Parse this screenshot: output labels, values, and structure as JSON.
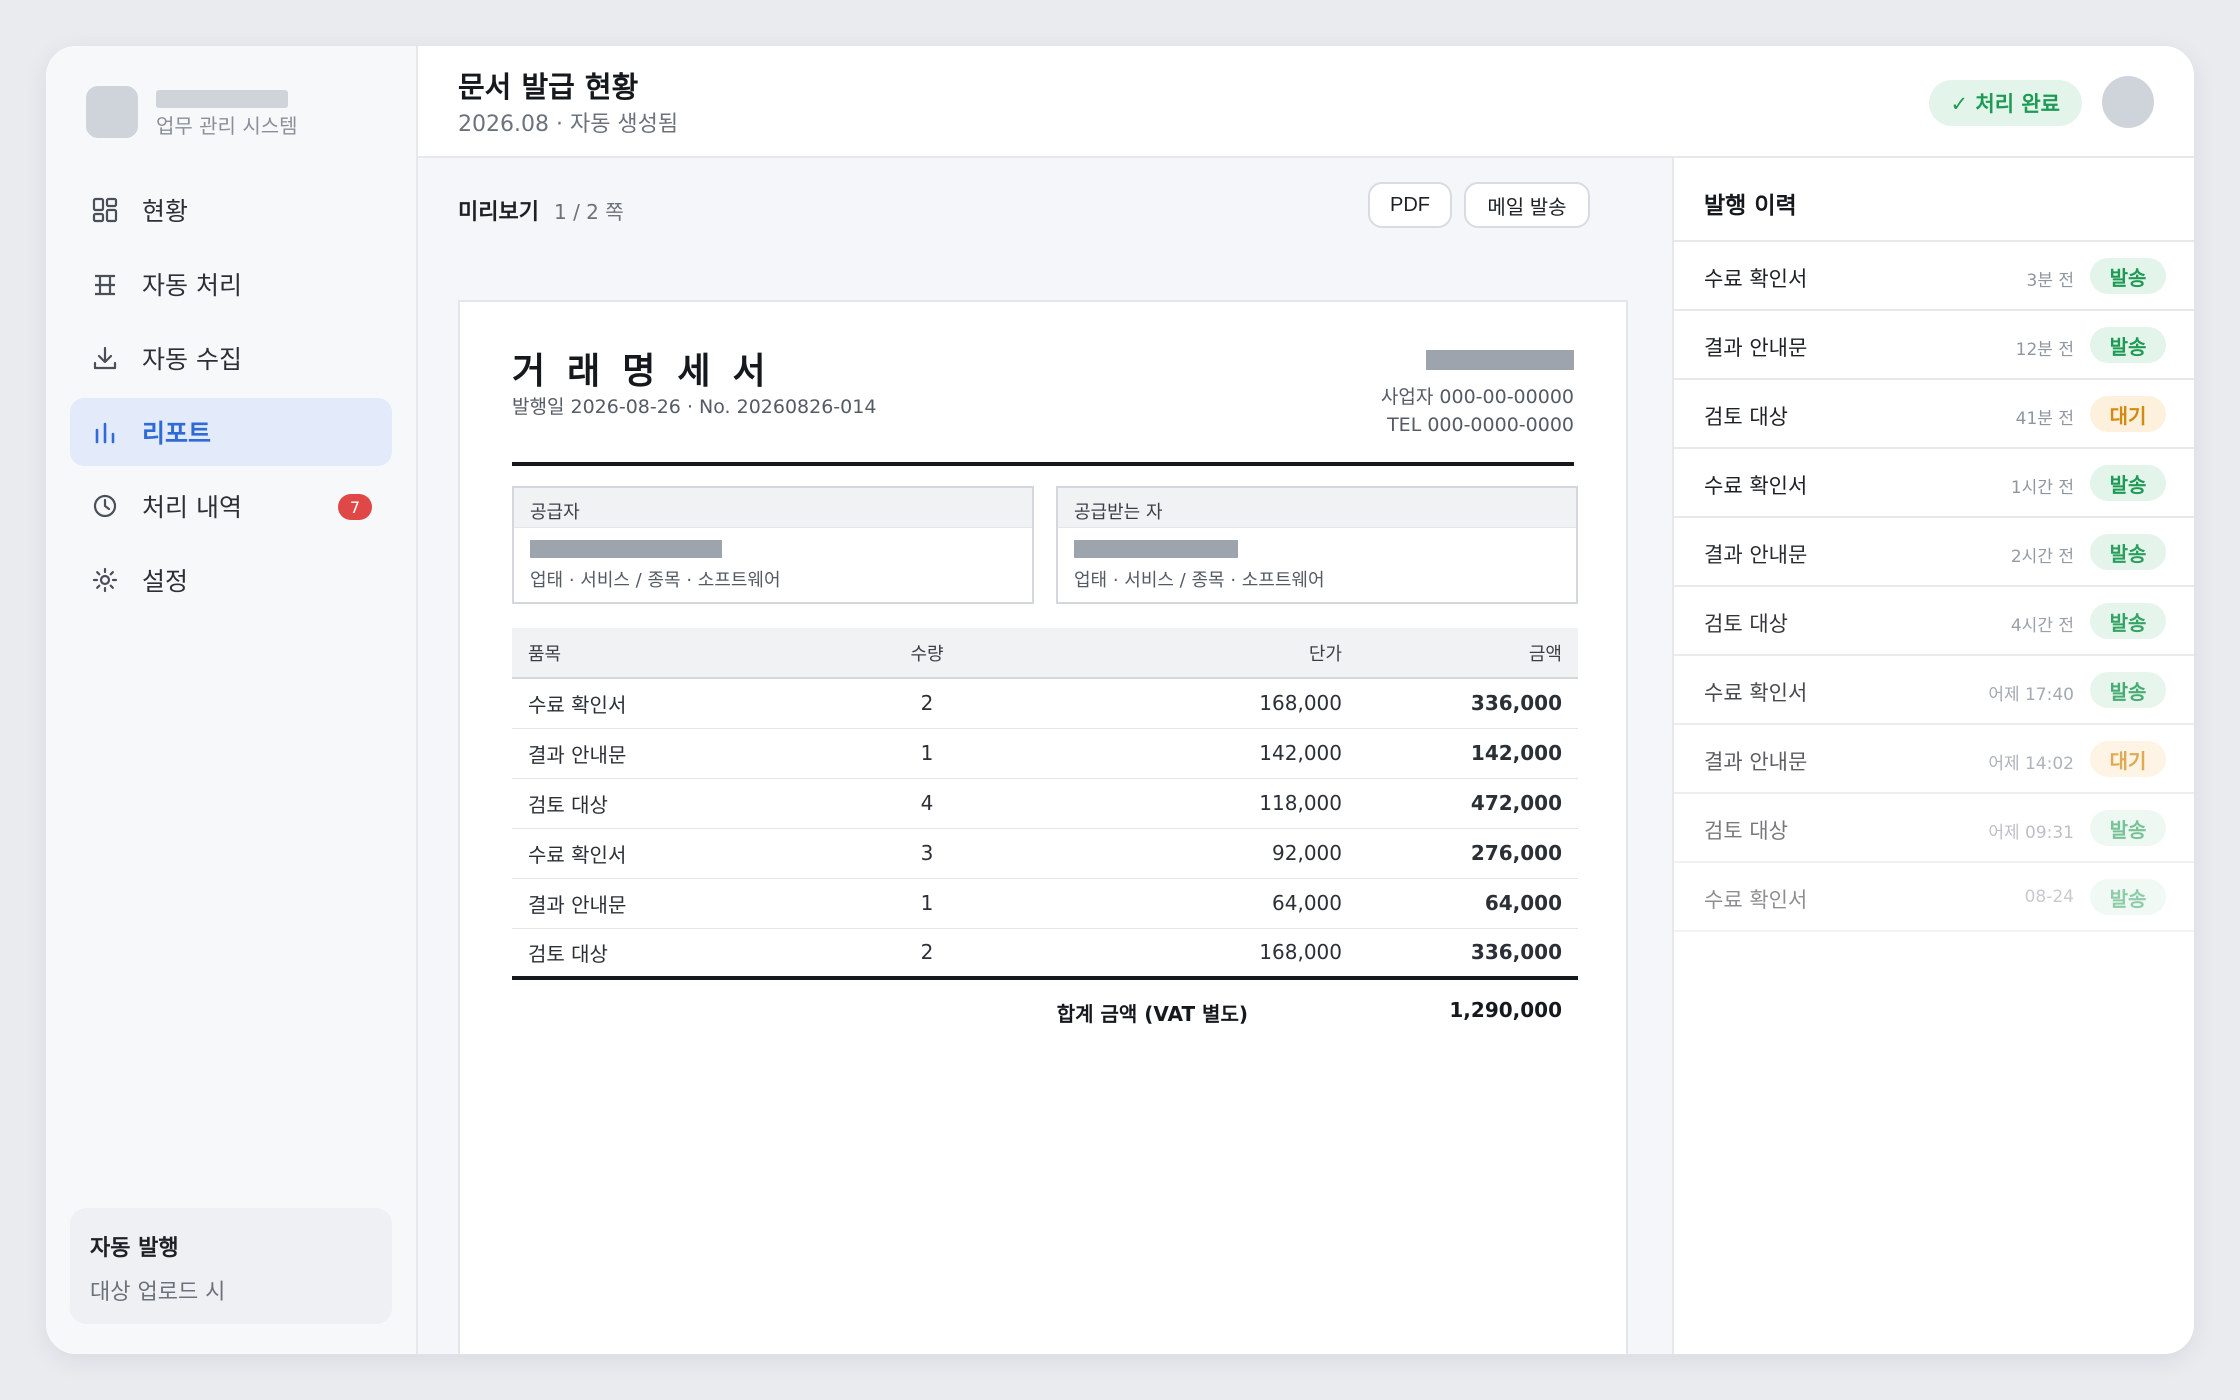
{
  "brand": {
    "subtitle": "업무 관리 시스템"
  },
  "sidebar": {
    "items": [
      {
        "label": "현황",
        "icon": "grid-icon"
      },
      {
        "label": "자동 처리",
        "icon": "table-icon"
      },
      {
        "label": "자동 수집",
        "icon": "download-icon"
      },
      {
        "label": "리포트",
        "icon": "bar-chart-icon",
        "active": true
      },
      {
        "label": "처리 내역",
        "icon": "clock-icon",
        "badge": "7"
      },
      {
        "label": "설정",
        "icon": "settings-icon"
      }
    ],
    "auto_card": {
      "title": "자동 발행",
      "subtitle": "대상 업로드 시"
    }
  },
  "header": {
    "title": "문서 발급 현황",
    "subtitle": "2026.08 · 자동 생성됨",
    "status": "✓ 처리 완료"
  },
  "preview": {
    "label": "미리보기",
    "page": "1 / 2 쪽",
    "pdf_button": "PDF",
    "mail_button": "메일 발송"
  },
  "document": {
    "title": "거래명세서",
    "meta": "발행일 2026-08-26 · No. 20260826-014",
    "business_no": "사업자 000-00-00000",
    "tel": "TEL 000-0000-0000",
    "supplier": {
      "heading": "공급자",
      "detail": "업태 · 서비스 / 종목 · 소프트웨어"
    },
    "recipient": {
      "heading": "공급받는 자",
      "detail": "업태 · 서비스 / 종목 · 소프트웨어"
    },
    "columns": [
      "품목",
      "수량",
      "단가",
      "금액"
    ],
    "rows": [
      {
        "name": "수료 확인서",
        "qty": "2",
        "price": "168,000",
        "amount": "336,000"
      },
      {
        "name": "결과 안내문",
        "qty": "1",
        "price": "142,000",
        "amount": "142,000"
      },
      {
        "name": "검토 대상",
        "qty": "4",
        "price": "118,000",
        "amount": "472,000"
      },
      {
        "name": "수료 확인서",
        "qty": "3",
        "price": "92,000",
        "amount": "276,000"
      },
      {
        "name": "결과 안내문",
        "qty": "1",
        "price": "64,000",
        "amount": "64,000"
      },
      {
        "name": "검토 대상",
        "qty": "2",
        "price": "168,000",
        "amount": "336,000"
      }
    ],
    "total_label": "합계 금액 (VAT 별도)",
    "total_amount": "1,290,000"
  },
  "history": {
    "title": "발행 이력",
    "items": [
      {
        "name": "수료 확인서",
        "time": "3분 전",
        "status": "발송",
        "state": "sent"
      },
      {
        "name": "결과 안내문",
        "time": "12분 전",
        "status": "발송",
        "state": "sent"
      },
      {
        "name": "검토 대상",
        "time": "41분 전",
        "status": "대기",
        "state": "wait"
      },
      {
        "name": "수료 확인서",
        "time": "1시간 전",
        "status": "발송",
        "state": "sent"
      },
      {
        "name": "결과 안내문",
        "time": "2시간 전",
        "status": "발송",
        "state": "sent"
      },
      {
        "name": "검토 대상",
        "time": "4시간 전",
        "status": "발송",
        "state": "sent"
      },
      {
        "name": "수료 확인서",
        "time": "어제 17:40",
        "status": "발송",
        "state": "sent"
      },
      {
        "name": "결과 안내문",
        "time": "어제 14:02",
        "status": "대기",
        "state": "wait"
      },
      {
        "name": "검토 대상",
        "time": "어제 09:31",
        "status": "발송",
        "state": "sent"
      },
      {
        "name": "수료 확인서",
        "time": "08-24",
        "status": "발송",
        "state": "sent"
      }
    ]
  },
  "colors": {
    "accent": "#2f6bd6",
    "success": "#1f9a55",
    "warning": "#d48a10",
    "danger": "#e04848"
  }
}
